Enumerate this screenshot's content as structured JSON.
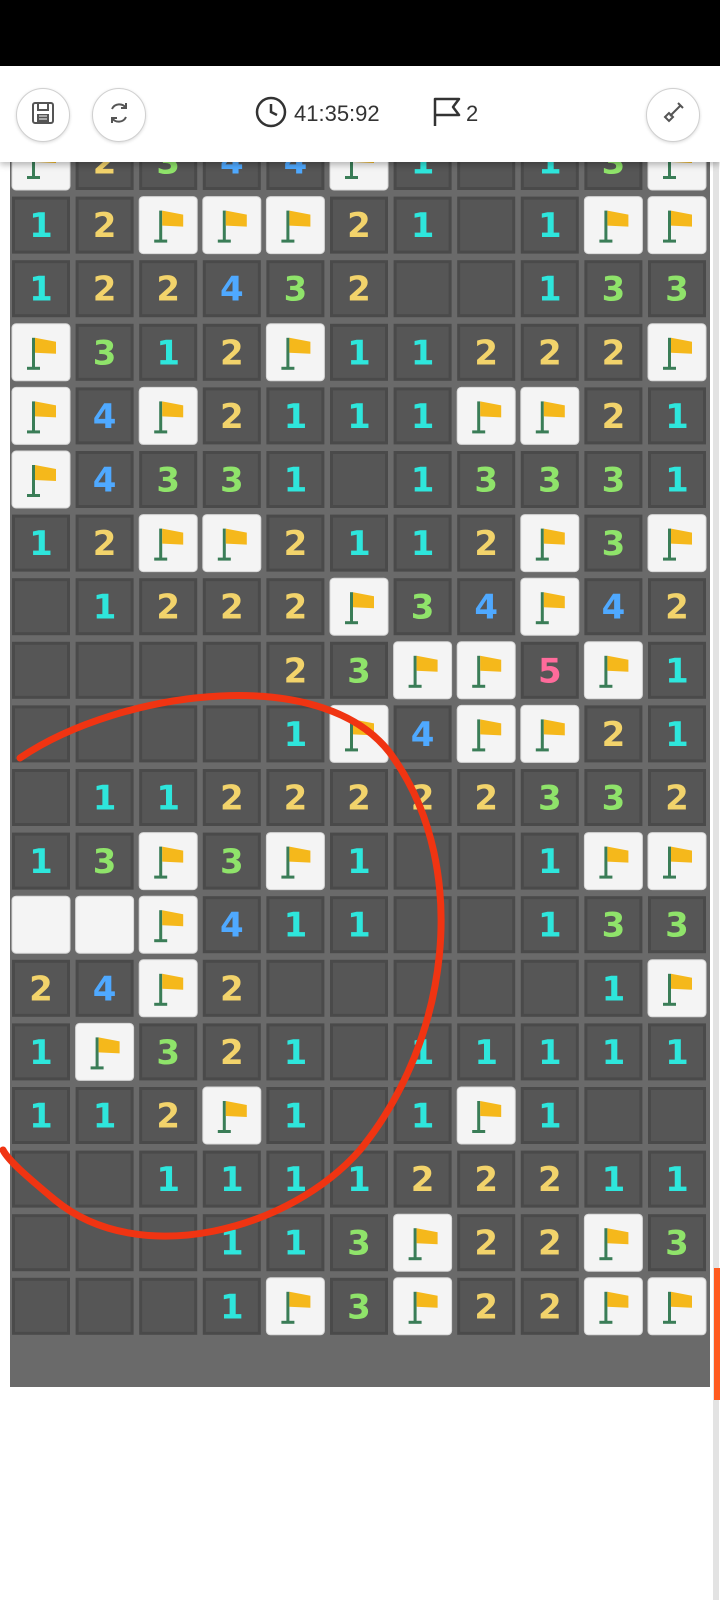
{
  "toolbar": {
    "save_icon": "save-icon",
    "restart_icon": "restart-icon",
    "timer_icon": "clock-icon",
    "timer": "41:35:92",
    "flag_icon": "flag-outline-icon",
    "flags_count": "2",
    "shovel_icon": "shovel-icon"
  },
  "board": {
    "cols": 11,
    "legend": {
      "F": "flag",
      "E": "empty-opened",
      "U": "unopened",
      "digits": "number of adjacent mines"
    },
    "rows": [
      [
        "F",
        "2",
        "3",
        "4",
        "4",
        "F",
        "1",
        "E",
        "1",
        "3",
        "F"
      ],
      [
        "1",
        "2",
        "F",
        "F",
        "F",
        "2",
        "1",
        "E",
        "1",
        "F",
        "F"
      ],
      [
        "1",
        "2",
        "2",
        "4",
        "3",
        "2",
        "E",
        "E",
        "1",
        "3",
        "3"
      ],
      [
        "F",
        "3",
        "1",
        "2",
        "F",
        "1",
        "1",
        "2",
        "2",
        "2",
        "F"
      ],
      [
        "F",
        "4",
        "F",
        "2",
        "1",
        "1",
        "1",
        "F",
        "F",
        "2",
        "1"
      ],
      [
        "F",
        "4",
        "3",
        "3",
        "1",
        "E",
        "1",
        "3",
        "3",
        "3",
        "1"
      ],
      [
        "1",
        "2",
        "F",
        "F",
        "2",
        "1",
        "1",
        "2",
        "F",
        "3",
        "F"
      ],
      [
        "E",
        "1",
        "2",
        "2",
        "2",
        "F",
        "3",
        "4",
        "F",
        "4",
        "2"
      ],
      [
        "E",
        "E",
        "E",
        "E",
        "2",
        "3",
        "F",
        "F",
        "5",
        "F",
        "1"
      ],
      [
        "E",
        "E",
        "E",
        "E",
        "1",
        "F",
        "4",
        "F",
        "F",
        "2",
        "1"
      ],
      [
        "E",
        "1",
        "1",
        "2",
        "2",
        "2",
        "2",
        "2",
        "3",
        "3",
        "2"
      ],
      [
        "1",
        "3",
        "F",
        "3",
        "F",
        "1",
        "E",
        "E",
        "1",
        "F",
        "F"
      ],
      [
        "U",
        "U",
        "F",
        "4",
        "1",
        "1",
        "E",
        "E",
        "1",
        "3",
        "3"
      ],
      [
        "2",
        "4",
        "F",
        "2",
        "E",
        "E",
        "E",
        "E",
        "E",
        "1",
        "F"
      ],
      [
        "1",
        "F",
        "3",
        "2",
        "1",
        "E",
        "1",
        "1",
        "1",
        "1",
        "1"
      ],
      [
        "1",
        "1",
        "2",
        "F",
        "1",
        "E",
        "1",
        "F",
        "1",
        "E",
        "E"
      ],
      [
        "E",
        "E",
        "1",
        "1",
        "1",
        "1",
        "2",
        "2",
        "2",
        "1",
        "1"
      ],
      [
        "E",
        "E",
        "E",
        "1",
        "1",
        "3",
        "F",
        "2",
        "2",
        "F",
        "3"
      ],
      [
        "E",
        "E",
        "E",
        "1",
        "F",
        "3",
        "F",
        "2",
        "2",
        "F",
        "F"
      ]
    ]
  },
  "colors": {
    "1": "#2ee6dc",
    "2": "#f2d36b",
    "3": "#8fe36a",
    "4": "#4fa9ff",
    "5": "#ff6b9b",
    "flag": "#f5b81b",
    "annotation": "#f03412"
  }
}
